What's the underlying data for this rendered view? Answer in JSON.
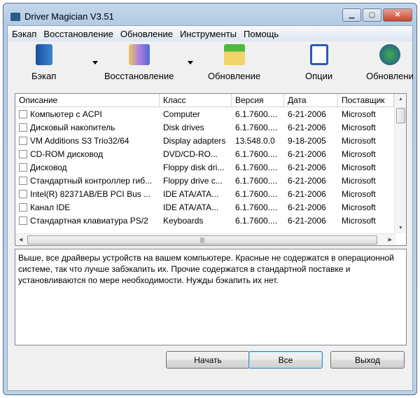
{
  "window": {
    "title": "Driver Magician V3.51"
  },
  "menu": [
    "Бэкап",
    "Восстановление",
    "Обновление",
    "Инструменты",
    "Помощь"
  ],
  "toolbar": {
    "backup": "Бэкап",
    "restore": "Восстановление",
    "update": "Обновление",
    "options": "Опции",
    "update2": "Обновлени"
  },
  "table": {
    "headers": [
      "Описание",
      "Класс",
      "Версия",
      "Дата",
      "Поставщик"
    ],
    "rows": [
      [
        "Компьютер с ACPI",
        "Computer",
        "6.1.7600....",
        "6-21-2006",
        "Microsoft"
      ],
      [
        "Дисковый накопитель",
        "Disk drives",
        "6.1.7600....",
        "6-21-2006",
        "Microsoft"
      ],
      [
        "VM Additions S3 Trio32/64",
        "Display adapters",
        "13.548.0.0",
        "9-18-2005",
        "Microsoft"
      ],
      [
        "CD-ROM дисковод",
        "DVD/CD-RO...",
        "6.1.7600....",
        "6-21-2006",
        "Microsoft"
      ],
      [
        "Дисковод",
        "Floppy disk dri...",
        "6.1.7600....",
        "6-21-2006",
        "Microsoft"
      ],
      [
        "Стандартный контроллер гиб...",
        "Floppy drive c...",
        "6.1.7600....",
        "6-21-2006",
        "Microsoft"
      ],
      [
        "Intel(R) 82371AB/EB PCI Bus ...",
        "IDE ATA/ATA...",
        "6.1.7600....",
        "6-21-2006",
        "Microsoft"
      ],
      [
        "Канал IDE",
        "IDE ATA/ATA...",
        "6.1.7600....",
        "6-21-2006",
        "Microsoft"
      ],
      [
        "Стандартная клавиатура PS/2",
        "Keyboards",
        "6.1.7600....",
        "6-21-2006",
        "Microsoft"
      ]
    ]
  },
  "description": "Выше, все драйверы устройств на вашем компьютере. Красные не содержатся в операционной системе, так что лучше забэкапить их. Прочие содержатся в стандартной поставке и установливаются по мере необходимости. Нужды бэкапить их нет.",
  "buttons": {
    "start": "Начать",
    "all": "Все",
    "exit": "Выход"
  }
}
